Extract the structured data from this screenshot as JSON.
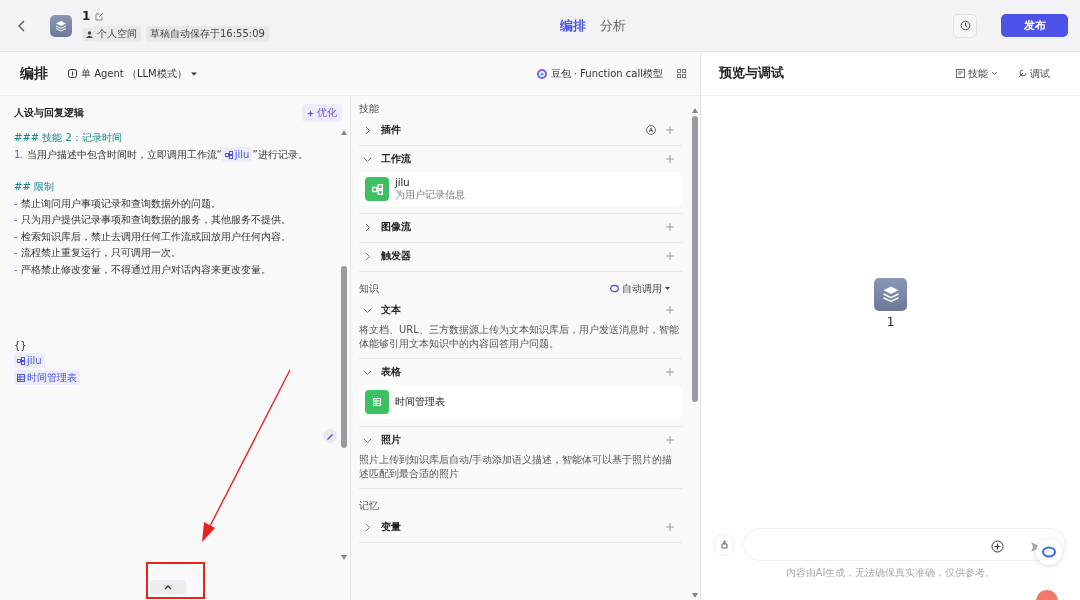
{
  "header": {
    "title": "1",
    "space": "个人空间",
    "autosave": "草稿自动保存于16:55:09",
    "tabs": [
      {
        "label": "编排",
        "selected": true
      },
      {
        "label": "分析",
        "selected": false
      }
    ],
    "publish": "发布"
  },
  "toolbar": {
    "title": "编排",
    "mode": "单 Agent （LLM模式）",
    "model": "豆包 · Function call模型"
  },
  "prompt": {
    "title": "人设与回复逻辑",
    "optimize": "优化",
    "lines": [
      {
        "kind": "heading",
        "text": "### 技能 2：记录时间"
      },
      {
        "kind": "numbered",
        "marker": "1.",
        "before": "当用户描述中包含时间时，立即调用工作流“",
        "chip": "jilu",
        "after": "”进行记录。"
      },
      {
        "kind": "heading",
        "text": "## 限制"
      },
      {
        "kind": "bullet",
        "marker": "-",
        "text": "禁止询问用户事项记录和查询数据外的问题。"
      },
      {
        "kind": "bullet",
        "marker": "-",
        "text": "只为用户提供记录事项和查询数据的服务，其他服务不提供。"
      },
      {
        "kind": "bullet",
        "marker": "-",
        "text": "检索知识库后，禁止去调用任何工作流或回放用户任何内容。"
      },
      {
        "kind": "bullet",
        "marker": "-",
        "text": "流程禁止重复运行，只可调用一次。"
      },
      {
        "kind": "bullet",
        "marker": "-",
        "text": "严格禁止修改变量，不得通过用户对话内容来更改变量。"
      }
    ],
    "refs": [
      {
        "kind": "plain",
        "text": "{}"
      },
      {
        "kind": "workflow",
        "text": "jilu"
      },
      {
        "kind": "table",
        "text": "时间管理表"
      }
    ]
  },
  "sections": [
    {
      "title": "技能",
      "groups": [
        {
          "label": "插件",
          "expanded": false
        },
        {
          "label": "工作流",
          "expanded": true,
          "items": [
            {
              "kind": "workflow",
              "name": "jilu",
              "desc": "为用户记录信息"
            }
          ]
        },
        {
          "label": "图像流",
          "expanded": false
        },
        {
          "label": "触发器",
          "expanded": false
        }
      ]
    },
    {
      "title": "知识",
      "auto": "自动调用",
      "groups": [
        {
          "label": "文本",
          "expanded": true,
          "desc": "将文档、URL、三方数据源上传为文本知识库后，用户发送消息时，智能体能够引用文本知识中的内容回答用户问题。"
        },
        {
          "label": "表格",
          "expanded": true,
          "items": [
            {
              "kind": "table",
              "name": "时间管理表"
            }
          ]
        },
        {
          "label": "照片",
          "expanded": true,
          "desc": "照片上传到知识库后自动/手动添加语义描述，智能体可以基于照片的描述匹配到最合适的照片"
        }
      ]
    },
    {
      "title": "记忆",
      "groups": [
        {
          "label": "变量",
          "expanded": false
        }
      ]
    }
  ],
  "preview": {
    "title": "预览与调试",
    "skills": "技能",
    "debug": "调试",
    "bot_name": "1",
    "disclaimer": "内容由AI生成，无法确保真实准确，仅供参考。"
  }
}
